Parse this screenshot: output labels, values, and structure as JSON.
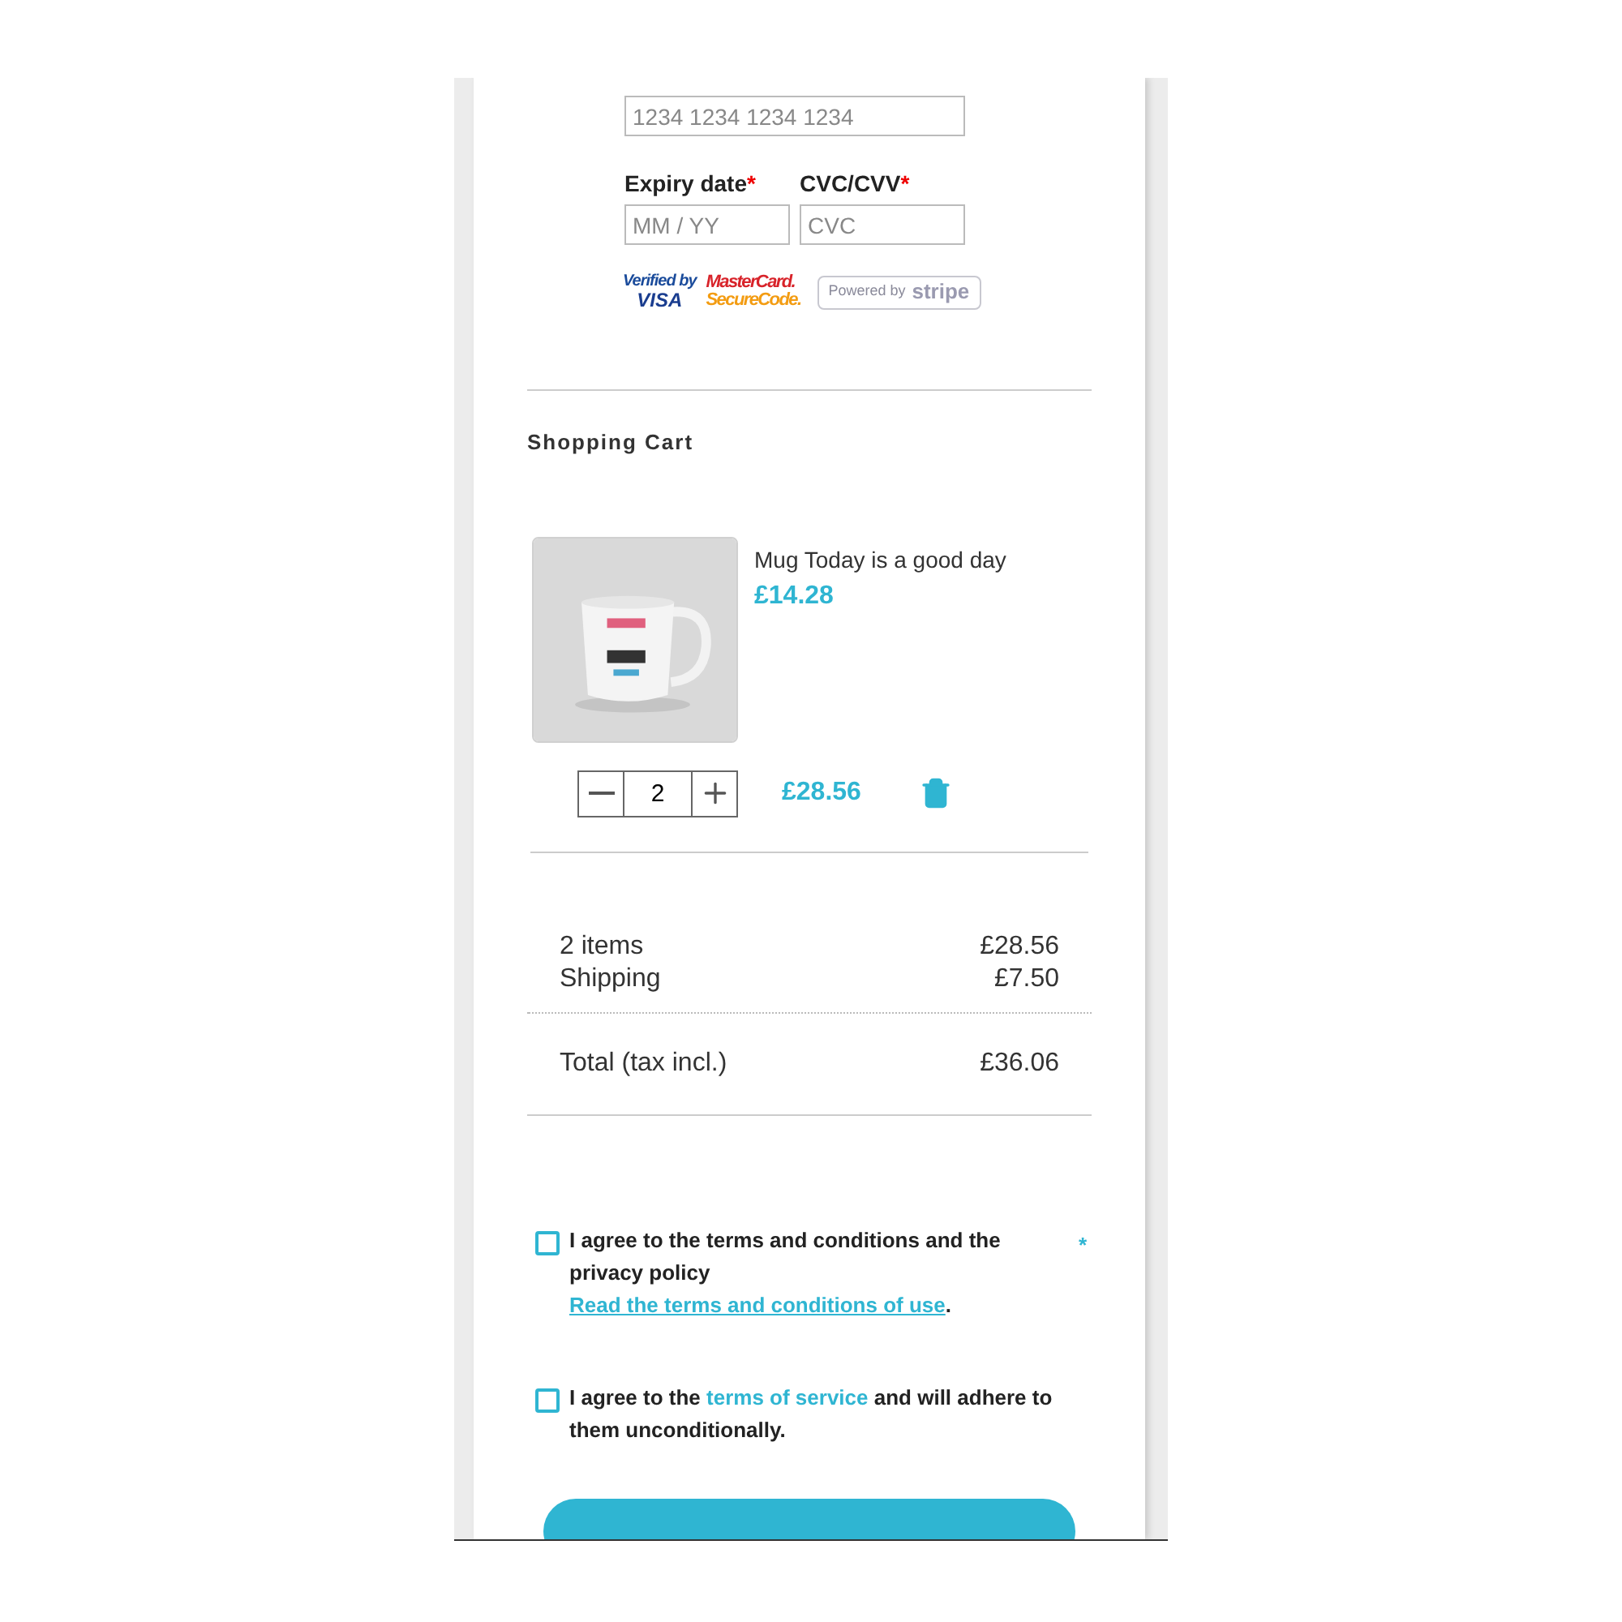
{
  "payment": {
    "card_number": {
      "placeholder": "1234 1234 1234 1234"
    },
    "expiry": {
      "label": "Expiry date",
      "required_mark": "*",
      "placeholder": "MM / YY"
    },
    "cvc": {
      "label": "CVC/CVV",
      "required_mark": "*",
      "placeholder": "CVC"
    },
    "badges": [
      {
        "kind": "visa",
        "top": "Verified by",
        "bottom": "VISA"
      },
      {
        "kind": "mastercard",
        "top": "MasterCard.",
        "bottom": "SecureCode."
      },
      {
        "kind": "stripe",
        "top": "Powered by",
        "bottom": "stripe"
      }
    ]
  },
  "cart": {
    "title": "Shopping Cart",
    "items": [
      {
        "name": "Mug Today is a good day",
        "unit_price": "£14.28",
        "quantity": "2",
        "line_total": "£28.56"
      }
    ],
    "summary": [
      {
        "label": "2 items",
        "value": "£28.56"
      },
      {
        "label": "Shipping",
        "value": "£7.50"
      }
    ],
    "total": {
      "label": "Total (tax incl.)",
      "value": "£36.06"
    }
  },
  "agreements": [
    {
      "checked": false,
      "before": "I agree to the terms and conditions and the privacy policy ",
      "link": "Read the terms and conditions of use",
      "underlined": true,
      "after": ".",
      "required_mark": "*"
    },
    {
      "checked": false,
      "before": "I agree to the ",
      "link": "terms of service",
      "underlined": false,
      "after": " and will adhere to them unconditionally."
    }
  ]
}
